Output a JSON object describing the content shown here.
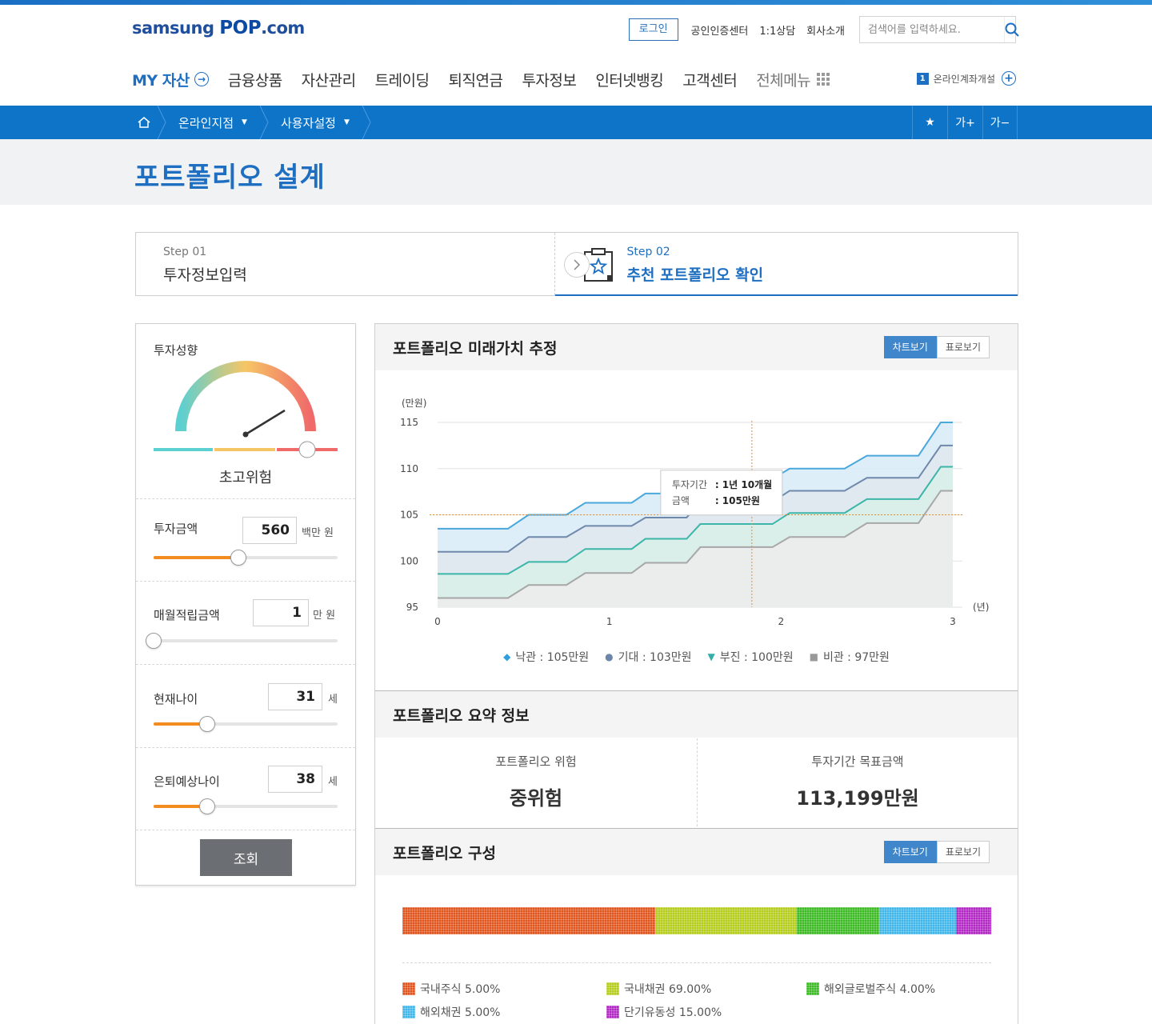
{
  "header": {
    "logo_text_pre": "samsung",
    "logo_text_pop": "POP",
    "logo_text_post": ".com",
    "login_label": "로그인",
    "util_links": [
      "공인인증센터",
      "1:1상담",
      "회사소개"
    ],
    "search_placeholder": "검색어를 입력하세요.",
    "gnb": {
      "my_asset": "MY 자산",
      "items": [
        "금융상품",
        "자산관리",
        "트레이딩",
        "퇴직연금",
        "투자정보",
        "인터넷뱅킹",
        "고객센터"
      ],
      "all_menu": "전체메뉴"
    },
    "open_account": {
      "badge": "1",
      "label": "온라인계좌개설"
    }
  },
  "locbar": {
    "crumbs": [
      "온라인지점",
      "사용자설정"
    ],
    "font_up": "가+",
    "font_down": "가−"
  },
  "page_title": "포트폴리오 설계",
  "steps": [
    {
      "label": "Step 01",
      "title": "투자정보입력"
    },
    {
      "label": "Step 02",
      "title": "추천 포트폴리오 확인"
    }
  ],
  "left_panel": {
    "risk_label": "투자성향",
    "risk_value": "초고위험",
    "fields": [
      {
        "label": "투자금액",
        "value": "560",
        "unit": "백만 원",
        "level": 0.46
      },
      {
        "label": "매월적립금액",
        "value": "1",
        "unit": "만 원",
        "level": 0.0
      },
      {
        "label": "현재나이",
        "value": "31",
        "unit": "세",
        "level": 0.29
      },
      {
        "label": "은퇴예상나이",
        "value": "38",
        "unit": "세",
        "level": 0.29
      }
    ],
    "query_button": "조회"
  },
  "future_value": {
    "title": "포트폴리오 미래가치 추정",
    "toggle_chart": "차트보기",
    "toggle_table": "표로보기",
    "tooltip": {
      "k1": "투자기간",
      "v1": ": 1년 10개월",
      "k2": "금액",
      "v2": ": 105만원"
    },
    "legend": [
      {
        "marker": "◆",
        "text": "낙관 : 105만원",
        "color": "#2f9fe0"
      },
      {
        "marker": "●",
        "text": "기대 : 103만원",
        "color": "#6b86a8"
      },
      {
        "marker": "▼",
        "text": "부진 : 100만원",
        "color": "#33b0a5"
      },
      {
        "marker": "■",
        "text": "비관 : 97만원",
        "color": "#999999"
      }
    ]
  },
  "chart_data": {
    "type": "area",
    "ylabel": "(만원)",
    "xlabel": "(년)",
    "ylim": [
      95,
      115
    ],
    "xlim": [
      0,
      3
    ],
    "y_ticks": [
      95,
      100,
      105,
      110,
      115
    ],
    "x_ticks": [
      0,
      1,
      2,
      3
    ],
    "series": [
      {
        "name": "낙관",
        "color": "#4aa8dc",
        "fill": "#d7ebf8",
        "x": [
          0,
          0.41,
          0.53,
          0.75,
          0.86,
          1.13,
          1.21,
          1.45,
          1.53,
          1.95,
          2.05,
          2.37,
          2.5,
          2.8,
          2.93,
          3.0
        ],
        "y": [
          103.5,
          103.5,
          105.0,
          105.0,
          106.3,
          106.3,
          107.3,
          107.3,
          108.9,
          108.9,
          110.0,
          110.0,
          111.4,
          111.4,
          115.0,
          115.0
        ]
      },
      {
        "name": "기대",
        "color": "#6f89ab",
        "fill": "#e1e6ee",
        "x": [
          0,
          0.41,
          0.53,
          0.75,
          0.86,
          1.13,
          1.21,
          1.45,
          1.53,
          1.95,
          2.05,
          2.37,
          2.5,
          2.8,
          2.93,
          3.0
        ],
        "y": [
          101.0,
          101.0,
          102.6,
          102.6,
          103.8,
          103.8,
          104.7,
          104.7,
          106.4,
          106.4,
          107.6,
          107.6,
          109.0,
          109.0,
          112.5,
          112.5
        ]
      },
      {
        "name": "부진",
        "color": "#3cb6a8",
        "fill": "#d8efe9",
        "x": [
          0,
          0.41,
          0.53,
          0.75,
          0.86,
          1.13,
          1.21,
          1.45,
          1.53,
          1.95,
          2.05,
          2.37,
          2.5,
          2.8,
          2.93,
          3.0
        ],
        "y": [
          98.6,
          98.6,
          99.9,
          99.9,
          101.3,
          101.3,
          102.4,
          102.4,
          104.0,
          104.0,
          105.2,
          105.2,
          106.7,
          106.7,
          110.2,
          110.2
        ]
      },
      {
        "name": "비관",
        "color": "#a7a7a7",
        "fill": "#ececec",
        "x": [
          0,
          0.41,
          0.53,
          0.75,
          0.86,
          1.13,
          1.21,
          1.45,
          1.53,
          1.95,
          2.05,
          2.37,
          2.5,
          2.8,
          2.93,
          3.0
        ],
        "y": [
          96.0,
          96.0,
          97.4,
          97.4,
          98.7,
          98.7,
          99.8,
          99.8,
          101.5,
          101.5,
          102.6,
          102.6,
          104.1,
          104.1,
          107.6,
          107.6
        ]
      }
    ],
    "marker": {
      "x": 1.83,
      "y": 105
    },
    "highlight_point": {
      "x": 1.45,
      "y": 107.2
    }
  },
  "summary": {
    "title": "포트폴리오 요약 정보",
    "risk_label": "포트폴리오 위험",
    "risk_value": "중위험",
    "target_label": "투자기간 목표금액",
    "target_value": "113,199만원"
  },
  "composition": {
    "title": "포트폴리오 구성",
    "toggle_chart": "차트보기",
    "toggle_table": "표로보기",
    "bar_segments": [
      {
        "name": "국내주식",
        "color": "#e0541c",
        "share": 0.43
      },
      {
        "name": "국내채권",
        "color": "#b5cc1a",
        "share": 0.24
      },
      {
        "name": "해외글로벌주식",
        "color": "#3cba24",
        "share": 0.14
      },
      {
        "name": "해외채권",
        "color": "#3fb6ea",
        "share": 0.13
      },
      {
        "name": "단기유동성",
        "color": "#b226c4",
        "share": 0.06
      }
    ],
    "legend": [
      {
        "text": "국내주식 5.00%",
        "color": "#e0541c"
      },
      {
        "text": "국내채권 69.00%",
        "color": "#b5cc1a"
      },
      {
        "text": "해외글로벌주식 4.00%",
        "color": "#3cba24"
      },
      {
        "text": "해외채권 5.00%",
        "color": "#3fb6ea"
      },
      {
        "text": "단기유동성 15.00%",
        "color": "#b226c4"
      }
    ]
  }
}
